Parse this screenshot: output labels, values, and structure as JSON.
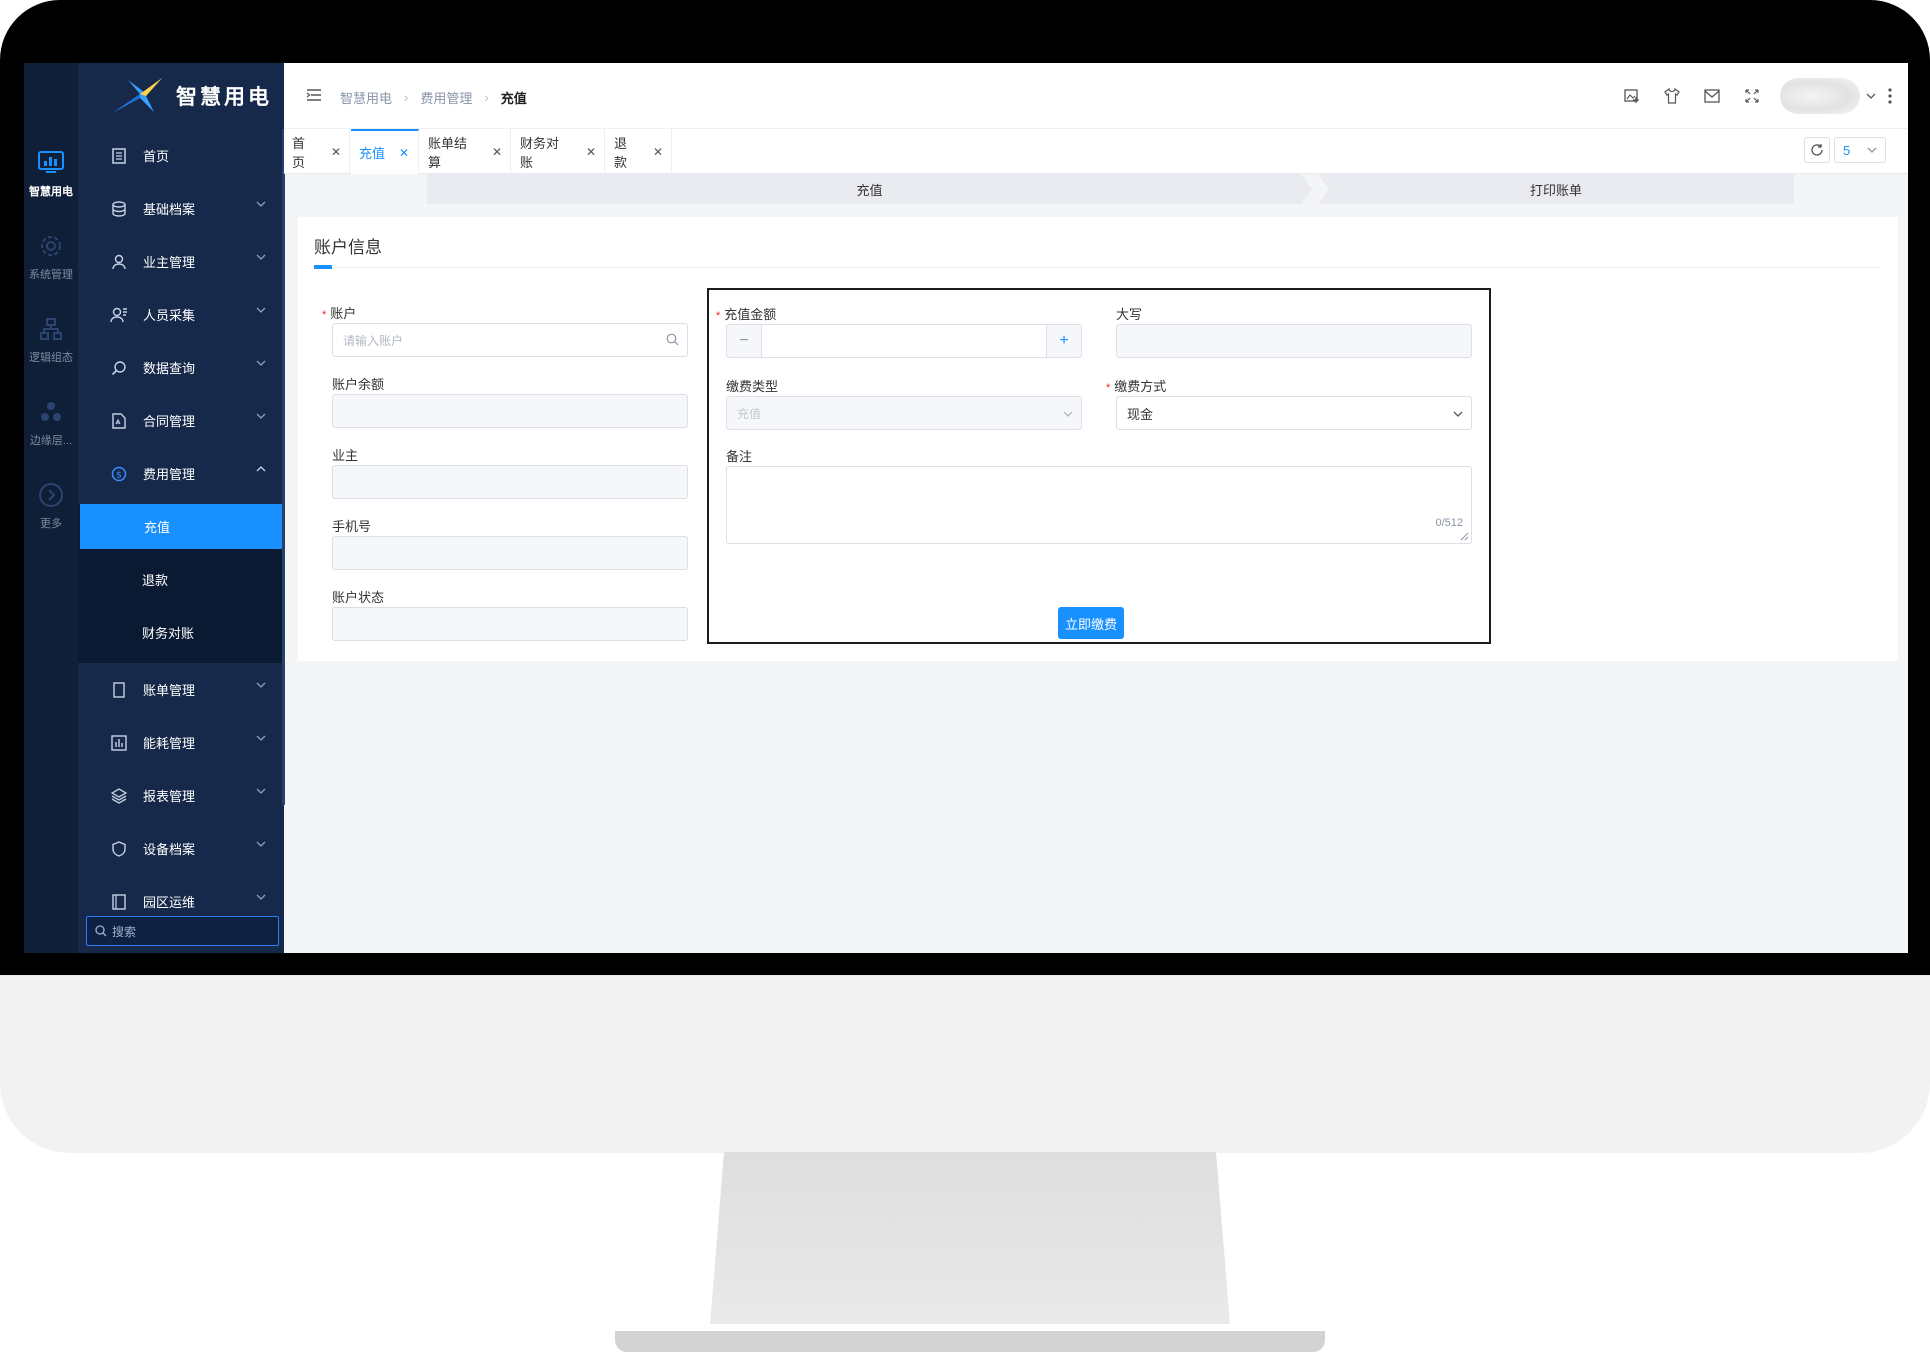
{
  "app": {
    "name": "智慧用电"
  },
  "rail": {
    "items": [
      {
        "label": "智慧用电",
        "icon": "monitor-chart-icon",
        "active": true
      },
      {
        "label": "系统管理",
        "icon": "gear-icon"
      },
      {
        "label": "逻辑组态",
        "icon": "hierarchy-icon"
      },
      {
        "label": "边缘层...",
        "icon": "cluster-icon"
      },
      {
        "label": "更多",
        "icon": "chevron-circle-icon"
      }
    ]
  },
  "sidebar": {
    "items": [
      {
        "label": "首页",
        "icon": "document-icon"
      },
      {
        "label": "基础档案",
        "icon": "database-icon"
      },
      {
        "label": "业主管理",
        "icon": "user-icon"
      },
      {
        "label": "人员采集",
        "icon": "users-icon"
      },
      {
        "label": "数据查询",
        "icon": "search-icon"
      },
      {
        "label": "合同管理",
        "icon": "contract-icon"
      },
      {
        "label": "费用管理",
        "icon": "dollar-circle-icon",
        "expanded": true
      },
      {
        "label": "账单管理",
        "icon": "bill-icon"
      },
      {
        "label": "能耗管理",
        "icon": "bar-chart-icon"
      },
      {
        "label": "报表管理",
        "icon": "layers-icon"
      },
      {
        "label": "设备档案",
        "icon": "shield-icon"
      },
      {
        "label": "园区运维",
        "icon": "book-icon"
      }
    ],
    "submenu": [
      {
        "label": "充值",
        "active": true
      },
      {
        "label": "退款"
      },
      {
        "label": "财务对账"
      }
    ],
    "search_placeholder": "搜索"
  },
  "header": {
    "breadcrumb": [
      "智慧用电",
      "费用管理",
      "充值"
    ],
    "icons": [
      "image-export-icon",
      "shirt-icon",
      "mail-icon",
      "fullscreen-icon",
      "kebab-icon"
    ]
  },
  "tabs": {
    "items": [
      {
        "label": "首页"
      },
      {
        "label": "充值",
        "active": true
      },
      {
        "label": "账单结算"
      },
      {
        "label": "财务对账"
      },
      {
        "label": "退款"
      }
    ],
    "close_glyph": "✕",
    "count": "5"
  },
  "steps": [
    "充值",
    "打印账单"
  ],
  "form": {
    "title": "账户信息",
    "account": {
      "label": "账户",
      "placeholder": "请输入账户",
      "required": true
    },
    "balance": {
      "label": "账户余额"
    },
    "owner": {
      "label": "业主"
    },
    "phone": {
      "label": "手机号"
    },
    "status": {
      "label": "账户状态"
    },
    "amount": {
      "label": "充值金额",
      "required": true,
      "minus": "−",
      "plus": "+"
    },
    "uppercase": {
      "label": "大写"
    },
    "pay_type": {
      "label": "缴费类型",
      "value": "充值"
    },
    "pay_method": {
      "label": "缴费方式",
      "value": "现金",
      "required": true
    },
    "remark": {
      "label": "备注",
      "counter": "0/512"
    },
    "submit": "立即缴费"
  },
  "colors": {
    "primary": "#1890ff",
    "sidebar": "#16294a",
    "rail": "#101f38",
    "required": "#f5222d"
  }
}
